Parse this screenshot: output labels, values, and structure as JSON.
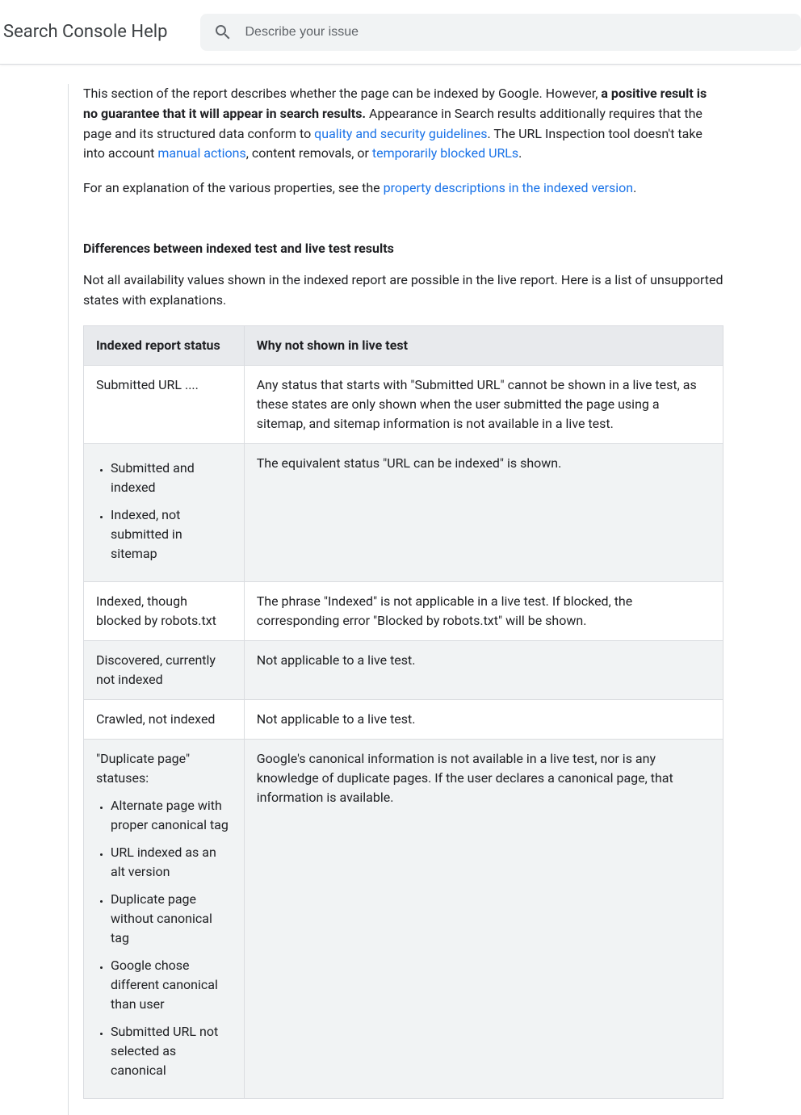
{
  "header": {
    "app_title": "Search Console Help",
    "search_placeholder": "Describe your issue"
  },
  "intro": {
    "p1_text1": "This section of the report describes whether the page can be indexed by Google. However, ",
    "p1_bold": "a positive result is no guarantee that it will appear in search results.",
    "p1_text2": " Appearance in Search results additionally requires that the page and its structured data conform to ",
    "p1_link1": "quality and security guidelines",
    "p1_text3": ". The URL Inspection tool doesn't take into account ",
    "p1_link2": "manual actions",
    "p1_text4": ", content removals, or ",
    "p1_link3": "temporarily blocked URLs",
    "p1_text5": ".",
    "p2_text1": "For an explanation of the various properties, see the ",
    "p2_link1": "property descriptions in the indexed version",
    "p2_text2": "."
  },
  "section": {
    "heading": "Differences between indexed test and live test results",
    "intro": "Not all availability values shown in the indexed report are possible in the live report. Here is a list of unsupported states with explanations."
  },
  "table": {
    "headers": {
      "col1": "Indexed report status",
      "col2": "Why not shown in live test"
    },
    "rows": [
      {
        "col1_text": "Submitted URL ....",
        "col2": "Any status that starts with \"Submitted URL\" cannot be shown in a live test, as these states are only shown when the user submitted the page using a sitemap, and sitemap information is not available in a live test."
      },
      {
        "col1_list": [
          "Submitted and indexed",
          "Indexed, not submitted in sitemap"
        ],
        "col2": "The equivalent status \"URL can be indexed\" is shown."
      },
      {
        "col1_text": "Indexed, though blocked by robots.txt",
        "col2": "The phrase \"Indexed\" is not applicable in a live test. If blocked, the corresponding error \"Blocked by robots.txt\" will be shown."
      },
      {
        "col1_text": "Discovered, currently not indexed",
        "col2": "Not applicable to a live test."
      },
      {
        "col1_text": "Crawled, not indexed",
        "col2": "Not applicable to a live test."
      },
      {
        "col1_label": "\"Duplicate page\" statuses:",
        "col1_list": [
          "Alternate page with proper canonical tag",
          "URL indexed as an alt version",
          "Duplicate page without canonical tag",
          "Google chose different canonical than user",
          "Submitted URL not selected as canonical"
        ],
        "col2": "Google's canonical information is not available in a live test, nor is any knowledge of duplicate pages. If the user declares a canonical page, that information is available."
      }
    ]
  }
}
